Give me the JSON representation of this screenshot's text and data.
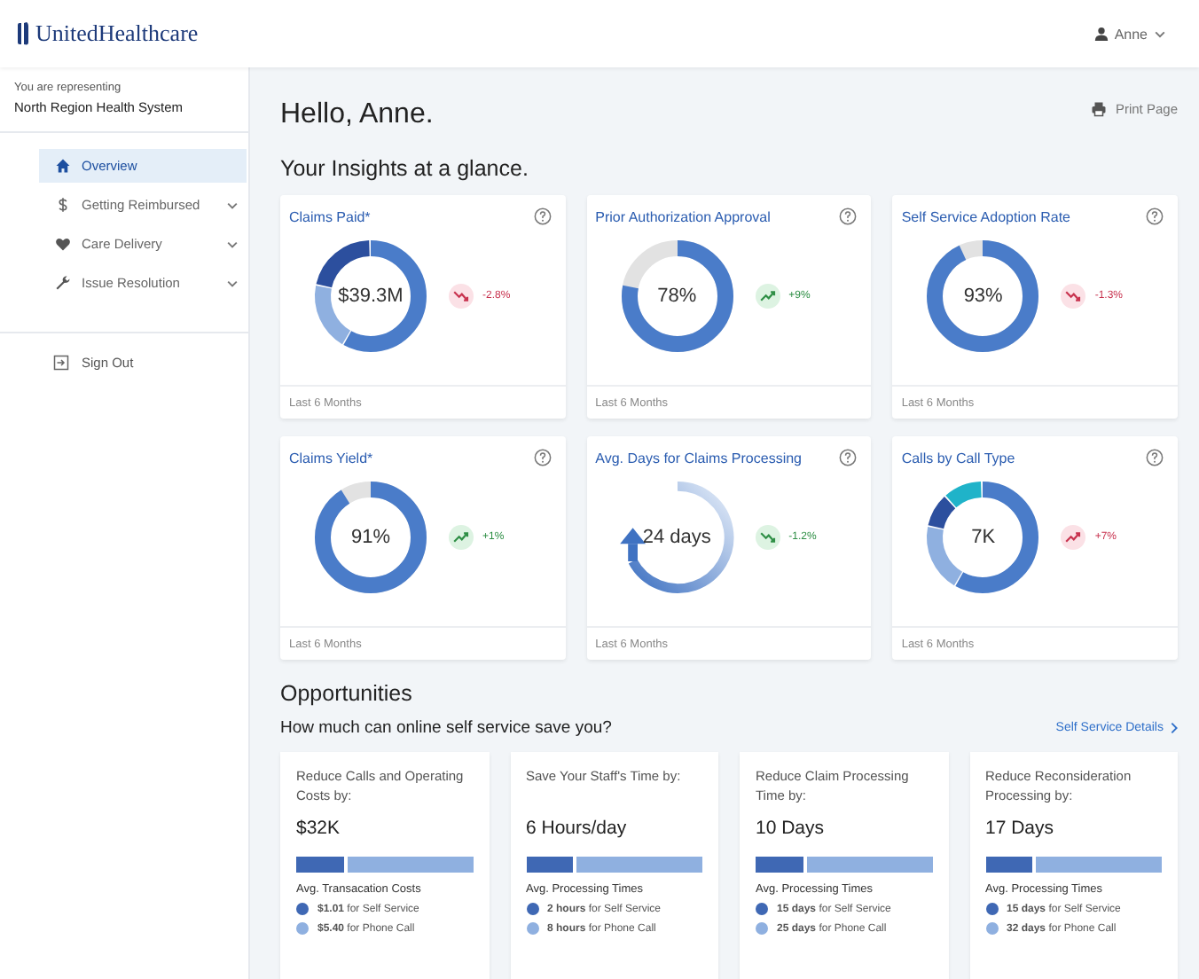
{
  "header": {
    "logo": "UnitedHealthcare",
    "user": "Anne"
  },
  "sidebar": {
    "representing_label": "You are representing",
    "organization": "North Region Health System",
    "items": [
      {
        "label": "Overview",
        "kind": "home",
        "selected": true,
        "expandable": false
      },
      {
        "label": "Getting Reimbursed",
        "kind": "dollar",
        "selected": false,
        "expandable": true
      },
      {
        "label": "Care Delivery",
        "kind": "heart",
        "selected": false,
        "expandable": true
      },
      {
        "label": "Issue Resolution",
        "kind": "wrench",
        "selected": false,
        "expandable": true
      }
    ],
    "sign_out": "Sign Out"
  },
  "greeting": "Hello, Anne.",
  "print": "Print Page",
  "insights_title": "Your Insights at a glance.",
  "insights": [
    {
      "title": "Claims Paid*",
      "kind": "split3",
      "value": "$39.3M",
      "rising": false,
      "good": false,
      "change": "-2.8%",
      "footer": "Last 6 Months"
    },
    {
      "title": "Prior Authorization Approval",
      "kind": "ring",
      "level": 0.78,
      "value": "78%",
      "rising": true,
      "good": true,
      "change": "+9%",
      "footer": "Last 6 Months"
    },
    {
      "title": "Self Service Adoption Rate",
      "kind": "ring",
      "level": 0.93,
      "value": "93%",
      "rising": false,
      "good": false,
      "change": "-1.3%",
      "footer": "Last 6 Months"
    },
    {
      "title": "Claims Yield*",
      "kind": "ring",
      "level": 0.91,
      "value": "91%",
      "rising": true,
      "good": true,
      "change": "+1%",
      "footer": "Last 6 Months"
    },
    {
      "title": "Avg. Days for Claims Processing",
      "kind": "cycle",
      "value": "24 days",
      "rising": false,
      "good": true,
      "change": "-1.2%",
      "footer": "Last 6 Months"
    },
    {
      "title": "Calls by Call Type",
      "kind": "split4",
      "value": "7K",
      "rising": true,
      "good": false,
      "change": "+7%",
      "footer": "Last 6 Months"
    }
  ],
  "opportunities": {
    "title": "Opportunities",
    "question": "How much can online self service save you?",
    "details_link": "Self Service Details",
    "cards": [
      {
        "title": "Reduce Calls and Operating Costs by:",
        "value": "$32K",
        "level": 0.27,
        "caption": "Avg. Transacation Costs",
        "legend": [
          "**$1.01** for Self Service",
          "**$5.40** for Phone Call"
        ]
      },
      {
        "title": "Save Your Staff's Time by:",
        "value": "6 Hours/day",
        "level": 0.27,
        "caption": "Avg. Processing Times",
        "legend": [
          "**2 hours** for Self Service",
          "**8 hours** for Phone Call"
        ]
      },
      {
        "title": "Reduce Claim Processing Time by:",
        "value": "10 Days",
        "level": 0.27,
        "caption": "Avg. Processing Times",
        "legend": [
          "**15 days** for Self Service",
          "**25 days** for Phone Call"
        ]
      },
      {
        "title": "Reduce Reconsideration Processing by:",
        "value": "17 Days",
        "level": 0.27,
        "caption": "Avg. Processing Times",
        "legend": [
          "**15 days** for Self Service",
          "**32 days** for Phone Call"
        ]
      }
    ]
  }
}
